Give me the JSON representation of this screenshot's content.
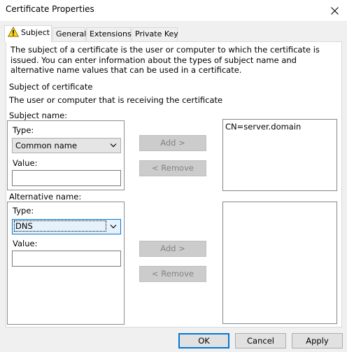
{
  "window": {
    "title": "Certificate Properties"
  },
  "tabs": [
    {
      "label": "Subject",
      "icon": "warning-icon"
    },
    {
      "label": "General"
    },
    {
      "label": "Extensions"
    },
    {
      "label": "Private Key"
    }
  ],
  "subject_tab": {
    "description": "The subject of a certificate is the user or computer to which the certificate is issued. You can enter information about the types of subject name and alternative name values that can be used in a certificate.",
    "section_title": "Subject of certificate",
    "section_subtitle": "The user or computer that is receiving the certificate",
    "subject_name": {
      "label": "Subject name:",
      "type_label": "Type:",
      "type_value": "Common name",
      "value_label": "Value:",
      "value": "",
      "add_label": "Add >",
      "remove_label": "< Remove",
      "list_items": [
        "CN=server.domain"
      ]
    },
    "alternative_name": {
      "label": "Alternative name:",
      "type_label": "Type:",
      "type_value": "DNS",
      "value_label": "Value:",
      "value": "",
      "add_label": "Add >",
      "remove_label": "< Remove",
      "list_items": []
    }
  },
  "footer": {
    "ok_label": "OK",
    "cancel_label": "Cancel",
    "apply_label": "Apply"
  },
  "colors": {
    "accent": "#0078d7",
    "warning": "#fcd116"
  }
}
